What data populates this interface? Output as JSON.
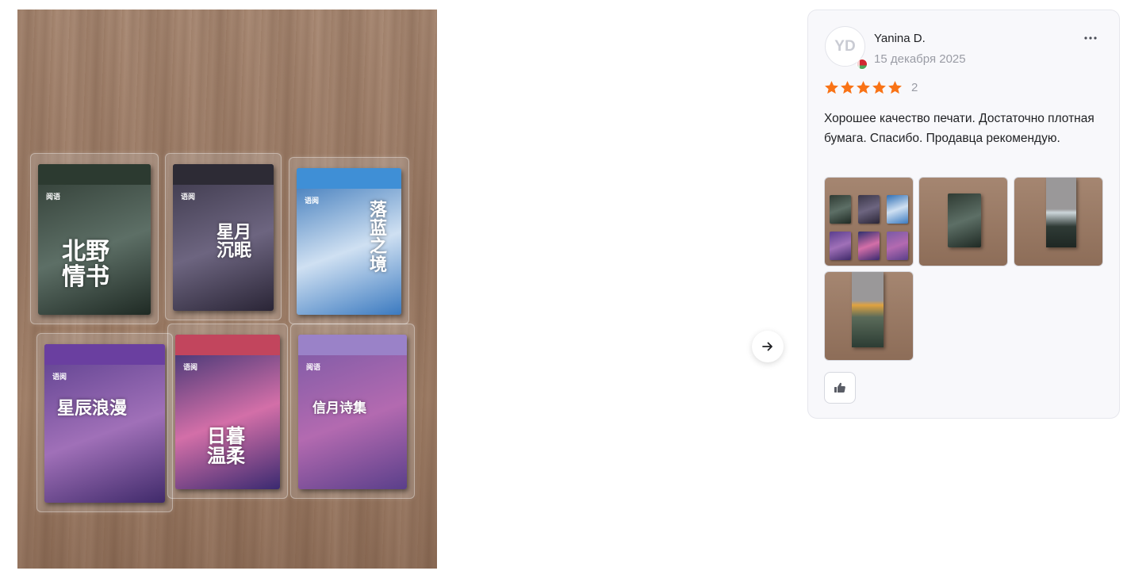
{
  "gallery": {
    "next_icon": "arrow-right-icon",
    "packs": [
      {
        "title": "北野\n情书",
        "brand": "阅语",
        "colors": [
          "#2f3b33",
          "#5d6f66",
          "#1f2a24"
        ],
        "band": "#2c3a30"
      },
      {
        "title": "星月\n沉眠",
        "brand": "语阅",
        "colors": [
          "#3a3648",
          "#6d6580",
          "#2a2536"
        ],
        "band": "#2d2b35"
      },
      {
        "title": "落\n蓝\n之\n境",
        "brand": "语阅",
        "colors": [
          "#2f6fb5",
          "#cfe0f2",
          "#3b7ac0"
        ],
        "band": "#3f8fd6"
      },
      {
        "title": "星辰浪漫",
        "brand": "语阅",
        "colors": [
          "#5b3f8e",
          "#a070b8",
          "#3f2a6a"
        ],
        "band": "#6a3fa0"
      },
      {
        "title": "日暮\n温柔",
        "brand": "语阅",
        "colors": [
          "#2e2f6e",
          "#d36fa8",
          "#3a2a70"
        ],
        "band": "#c2455d"
      },
      {
        "title": "信月诗集",
        "brand": "阅语",
        "colors": [
          "#7a5aa6",
          "#b36ab0",
          "#5a3f8a"
        ],
        "band": "#9a82c8"
      }
    ]
  },
  "review": {
    "avatar_initials": "YD",
    "author": "Yanina D.",
    "date": "15 декабря 2025",
    "more_icon": "more-horizontal-icon",
    "rating": 5,
    "star_color": "#f97316",
    "rating_count": "2",
    "text": "Хорошее качество печати. Достаточно плотная бумага. Спасибо. Продавца рекомендую.",
    "like_icon": "thumbs-up-icon",
    "flag_icon": "belarus-flag-icon"
  }
}
